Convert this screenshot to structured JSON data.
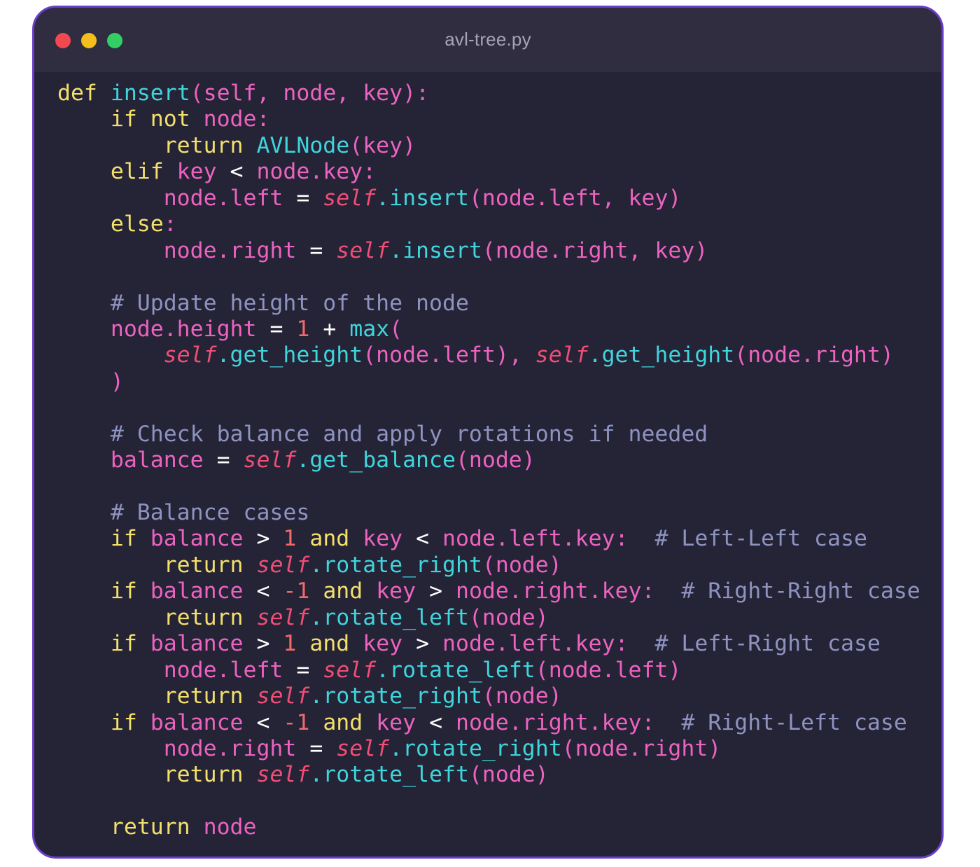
{
  "window": {
    "filename": "avl-tree.py",
    "colors": {
      "border": "#6a3fc8",
      "background": "#252336",
      "titlebar": "#302d41",
      "traffic_red": "#f2484f",
      "traffic_yellow": "#f4be1c",
      "traffic_green": "#33cf64"
    }
  },
  "syntax_colors": {
    "keyword": "#f2e06b",
    "function": "#3fd5dc",
    "self": "#f04e76",
    "number": "#f06a6a",
    "comment": "#8e93c0",
    "operator": "#ffffff",
    "identifier": "#ec63c0"
  },
  "code_lines": [
    [
      [
        "kw",
        "def"
      ],
      [
        "p",
        " "
      ],
      [
        "fn",
        "insert"
      ],
      [
        "p",
        "(self, node, key):"
      ]
    ],
    [
      [
        "p",
        "    "
      ],
      [
        "kw",
        "if not"
      ],
      [
        "p",
        " node:"
      ]
    ],
    [
      [
        "p",
        "        "
      ],
      [
        "kw",
        "return"
      ],
      [
        "p",
        " "
      ],
      [
        "fn",
        "AVLNode"
      ],
      [
        "p",
        "(key)"
      ]
    ],
    [
      [
        "p",
        "    "
      ],
      [
        "kw",
        "elif"
      ],
      [
        "p",
        " key "
      ],
      [
        "op",
        "<"
      ],
      [
        "p",
        " node.key:"
      ]
    ],
    [
      [
        "p",
        "        node.left "
      ],
      [
        "op",
        "="
      ],
      [
        "p",
        " "
      ],
      [
        "self",
        "self"
      ],
      [
        "fn",
        ".insert"
      ],
      [
        "p",
        "(node.left, key)"
      ]
    ],
    [
      [
        "p",
        "    "
      ],
      [
        "kw",
        "else"
      ],
      [
        "p",
        ":"
      ]
    ],
    [
      [
        "p",
        "        node.right "
      ],
      [
        "op",
        "="
      ],
      [
        "p",
        " "
      ],
      [
        "self",
        "self"
      ],
      [
        "fn",
        ".insert"
      ],
      [
        "p",
        "(node.right, key)"
      ]
    ],
    [],
    [
      [
        "p",
        "    "
      ],
      [
        "c",
        "# Update height of the node"
      ]
    ],
    [
      [
        "p",
        "    node.height "
      ],
      [
        "op",
        "="
      ],
      [
        "p",
        " "
      ],
      [
        "num",
        "1"
      ],
      [
        "p",
        " "
      ],
      [
        "op",
        "+"
      ],
      [
        "p",
        " "
      ],
      [
        "fn",
        "max"
      ],
      [
        "p",
        "("
      ]
    ],
    [
      [
        "p",
        "        "
      ],
      [
        "self",
        "self"
      ],
      [
        "fn",
        ".get_height"
      ],
      [
        "p",
        "(node.left), "
      ],
      [
        "self",
        "self"
      ],
      [
        "fn",
        ".get_height"
      ],
      [
        "p",
        "(node.right)"
      ]
    ],
    [
      [
        "p",
        "    )"
      ]
    ],
    [],
    [
      [
        "p",
        "    "
      ],
      [
        "c",
        "# Check balance and apply rotations if needed"
      ]
    ],
    [
      [
        "p",
        "    balance "
      ],
      [
        "op",
        "="
      ],
      [
        "p",
        " "
      ],
      [
        "self",
        "self"
      ],
      [
        "fn",
        ".get_balance"
      ],
      [
        "p",
        "(node)"
      ]
    ],
    [],
    [
      [
        "p",
        "    "
      ],
      [
        "c",
        "# Balance cases"
      ]
    ],
    [
      [
        "p",
        "    "
      ],
      [
        "kw",
        "if"
      ],
      [
        "p",
        " balance "
      ],
      [
        "op",
        ">"
      ],
      [
        "p",
        " "
      ],
      [
        "num",
        "1"
      ],
      [
        "p",
        " "
      ],
      [
        "kw",
        "and"
      ],
      [
        "p",
        " key "
      ],
      [
        "op",
        "<"
      ],
      [
        "p",
        " node.left.key:  "
      ],
      [
        "c",
        "# Left-Left case"
      ]
    ],
    [
      [
        "p",
        "        "
      ],
      [
        "kw",
        "return"
      ],
      [
        "p",
        " "
      ],
      [
        "self",
        "self"
      ],
      [
        "fn",
        ".rotate_right"
      ],
      [
        "p",
        "(node)"
      ]
    ],
    [
      [
        "p",
        "    "
      ],
      [
        "kw",
        "if"
      ],
      [
        "p",
        " balance "
      ],
      [
        "op",
        "<"
      ],
      [
        "p",
        " "
      ],
      [
        "num",
        "-1"
      ],
      [
        "p",
        " "
      ],
      [
        "kw",
        "and"
      ],
      [
        "p",
        " key "
      ],
      [
        "op",
        ">"
      ],
      [
        "p",
        " node.right.key:  "
      ],
      [
        "c",
        "# Right-Right case"
      ]
    ],
    [
      [
        "p",
        "        "
      ],
      [
        "kw",
        "return"
      ],
      [
        "p",
        " "
      ],
      [
        "self",
        "self"
      ],
      [
        "fn",
        ".rotate_left"
      ],
      [
        "p",
        "(node)"
      ]
    ],
    [
      [
        "p",
        "    "
      ],
      [
        "kw",
        "if"
      ],
      [
        "p",
        " balance "
      ],
      [
        "op",
        ">"
      ],
      [
        "p",
        " "
      ],
      [
        "num",
        "1"
      ],
      [
        "p",
        " "
      ],
      [
        "kw",
        "and"
      ],
      [
        "p",
        " key "
      ],
      [
        "op",
        ">"
      ],
      [
        "p",
        " node.left.key:  "
      ],
      [
        "c",
        "# Left-Right case"
      ]
    ],
    [
      [
        "p",
        "        node.left "
      ],
      [
        "op",
        "="
      ],
      [
        "p",
        " "
      ],
      [
        "self",
        "self"
      ],
      [
        "fn",
        ".rotate_left"
      ],
      [
        "p",
        "(node.left)"
      ]
    ],
    [
      [
        "p",
        "        "
      ],
      [
        "kw",
        "return"
      ],
      [
        "p",
        " "
      ],
      [
        "self",
        "self"
      ],
      [
        "fn",
        ".rotate_right"
      ],
      [
        "p",
        "(node)"
      ]
    ],
    [
      [
        "p",
        "    "
      ],
      [
        "kw",
        "if"
      ],
      [
        "p",
        " balance "
      ],
      [
        "op",
        "<"
      ],
      [
        "p",
        " "
      ],
      [
        "num",
        "-1"
      ],
      [
        "p",
        " "
      ],
      [
        "kw",
        "and"
      ],
      [
        "p",
        " key "
      ],
      [
        "op",
        "<"
      ],
      [
        "p",
        " node.right.key:  "
      ],
      [
        "c",
        "# Right-Left case"
      ]
    ],
    [
      [
        "p",
        "        node.right "
      ],
      [
        "op",
        "="
      ],
      [
        "p",
        " "
      ],
      [
        "self",
        "self"
      ],
      [
        "fn",
        ".rotate_right"
      ],
      [
        "p",
        "(node.right)"
      ]
    ],
    [
      [
        "p",
        "        "
      ],
      [
        "kw",
        "return"
      ],
      [
        "p",
        " "
      ],
      [
        "self",
        "self"
      ],
      [
        "fn",
        ".rotate_left"
      ],
      [
        "p",
        "(node)"
      ]
    ],
    [],
    [
      [
        "p",
        "    "
      ],
      [
        "kw",
        "return"
      ],
      [
        "p",
        " node"
      ]
    ]
  ]
}
